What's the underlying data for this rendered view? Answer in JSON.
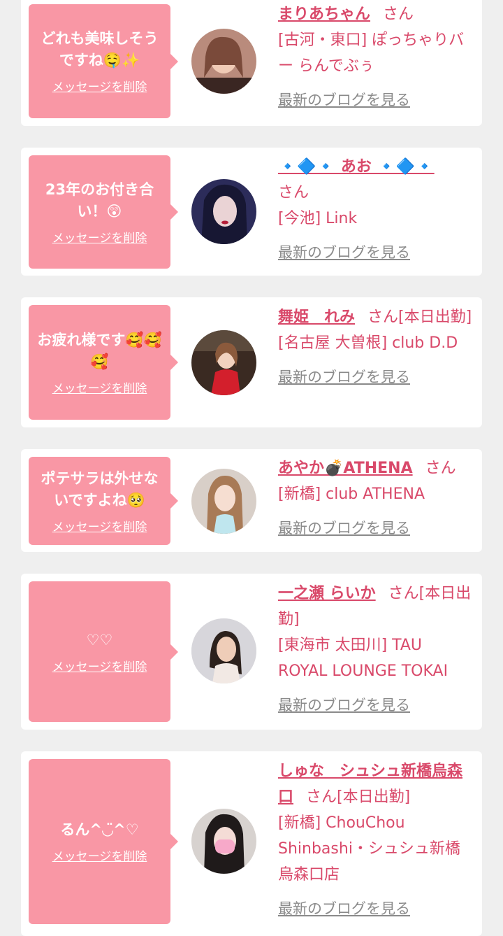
{
  "delete_label": "メッセージを削除",
  "blog_label": "最新のブログを見る",
  "suffix_san": "さん",
  "cards": [
    {
      "message": "どれも美味しそうですね🤤✨",
      "name": "まりあちゃん",
      "suffix": "さん",
      "store": "[古河・東口] ぽっちゃりバー らんでぶぅ"
    },
    {
      "message": "23年のお付き合い！😲",
      "name": "🔹🔷🔹 あお 🔹🔷🔹",
      "suffix": "さん",
      "store": "[今池] Link"
    },
    {
      "message": "お疲れ様です🥰🥰🥰",
      "name": "舞姫　れみ",
      "suffix": "さん[本日出勤]",
      "store": "[名古屋 大曽根] club D.D"
    },
    {
      "message": "ポテサラは外せないですよね🥺",
      "name": "あやか💣ATHENA",
      "suffix": "さん",
      "store": "[新橋] club ATHENA"
    },
    {
      "message": "♡♡",
      "name": "一之瀬 らいか",
      "suffix": "さん[本日出勤]",
      "store": "[東海市 太田川] TAU ROYAL LOUNGE TOKAI"
    },
    {
      "message": "るん^◡̈^♡",
      "name": "しゅな　シュシュ新橋烏森口",
      "suffix": "さん[本日出勤]",
      "store": "[新橋] ChouChou Shinbashi・シュシュ新橋烏森口店"
    }
  ]
}
